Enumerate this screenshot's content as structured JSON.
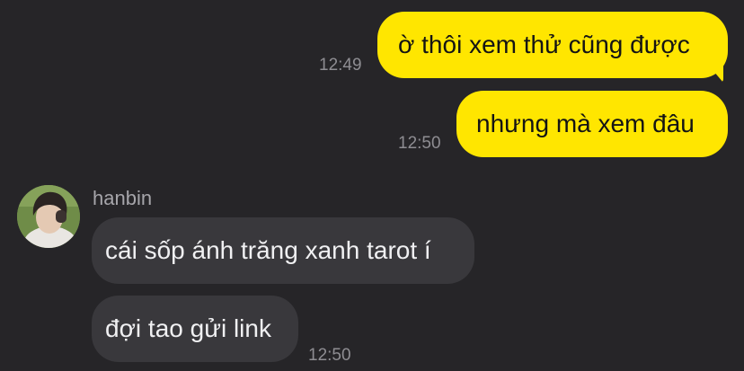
{
  "chat": {
    "messages": [
      {
        "direction": "outgoing",
        "text": "ờ thôi xem thử cũng được",
        "time": "12:49"
      },
      {
        "direction": "outgoing",
        "text": "nhưng mà xem đâu",
        "time": "12:50"
      },
      {
        "direction": "incoming",
        "sender": "hanbin",
        "text": "cái sốp ánh trăng xanh tarot í",
        "time": ""
      },
      {
        "direction": "incoming",
        "text": "đợi tao gửi link",
        "time": "12:50"
      }
    ],
    "avatar_icon": "profile-photo-icon"
  },
  "colors": {
    "background": "#262528",
    "outgoing_bubble": "#ffe600",
    "incoming_bubble": "#39383c",
    "timestamp": "#8e8d92"
  }
}
